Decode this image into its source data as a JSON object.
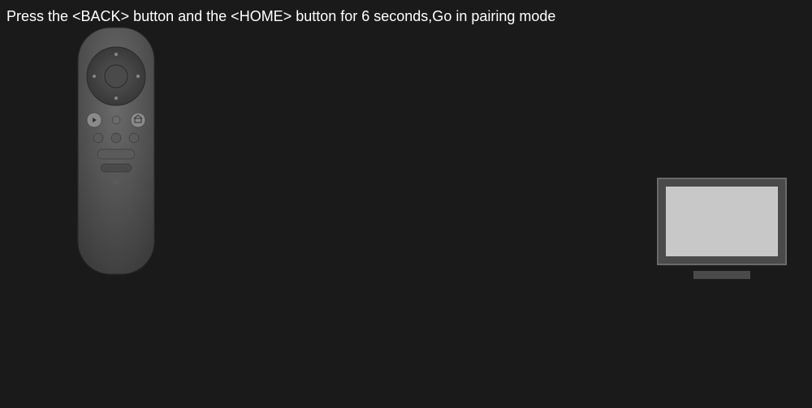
{
  "instruction": "Press the <BACK> button and the <HOME> button for 6 seconds,Go in pairing mode",
  "colors": {
    "background": "#1a1a1a",
    "text": "#ffffff",
    "remoteBody": "#5a5a5a",
    "remoteAccent": "#7a7a7a",
    "tvFrame": "#4a4a4a",
    "tvScreen": "#c8c8c8"
  }
}
